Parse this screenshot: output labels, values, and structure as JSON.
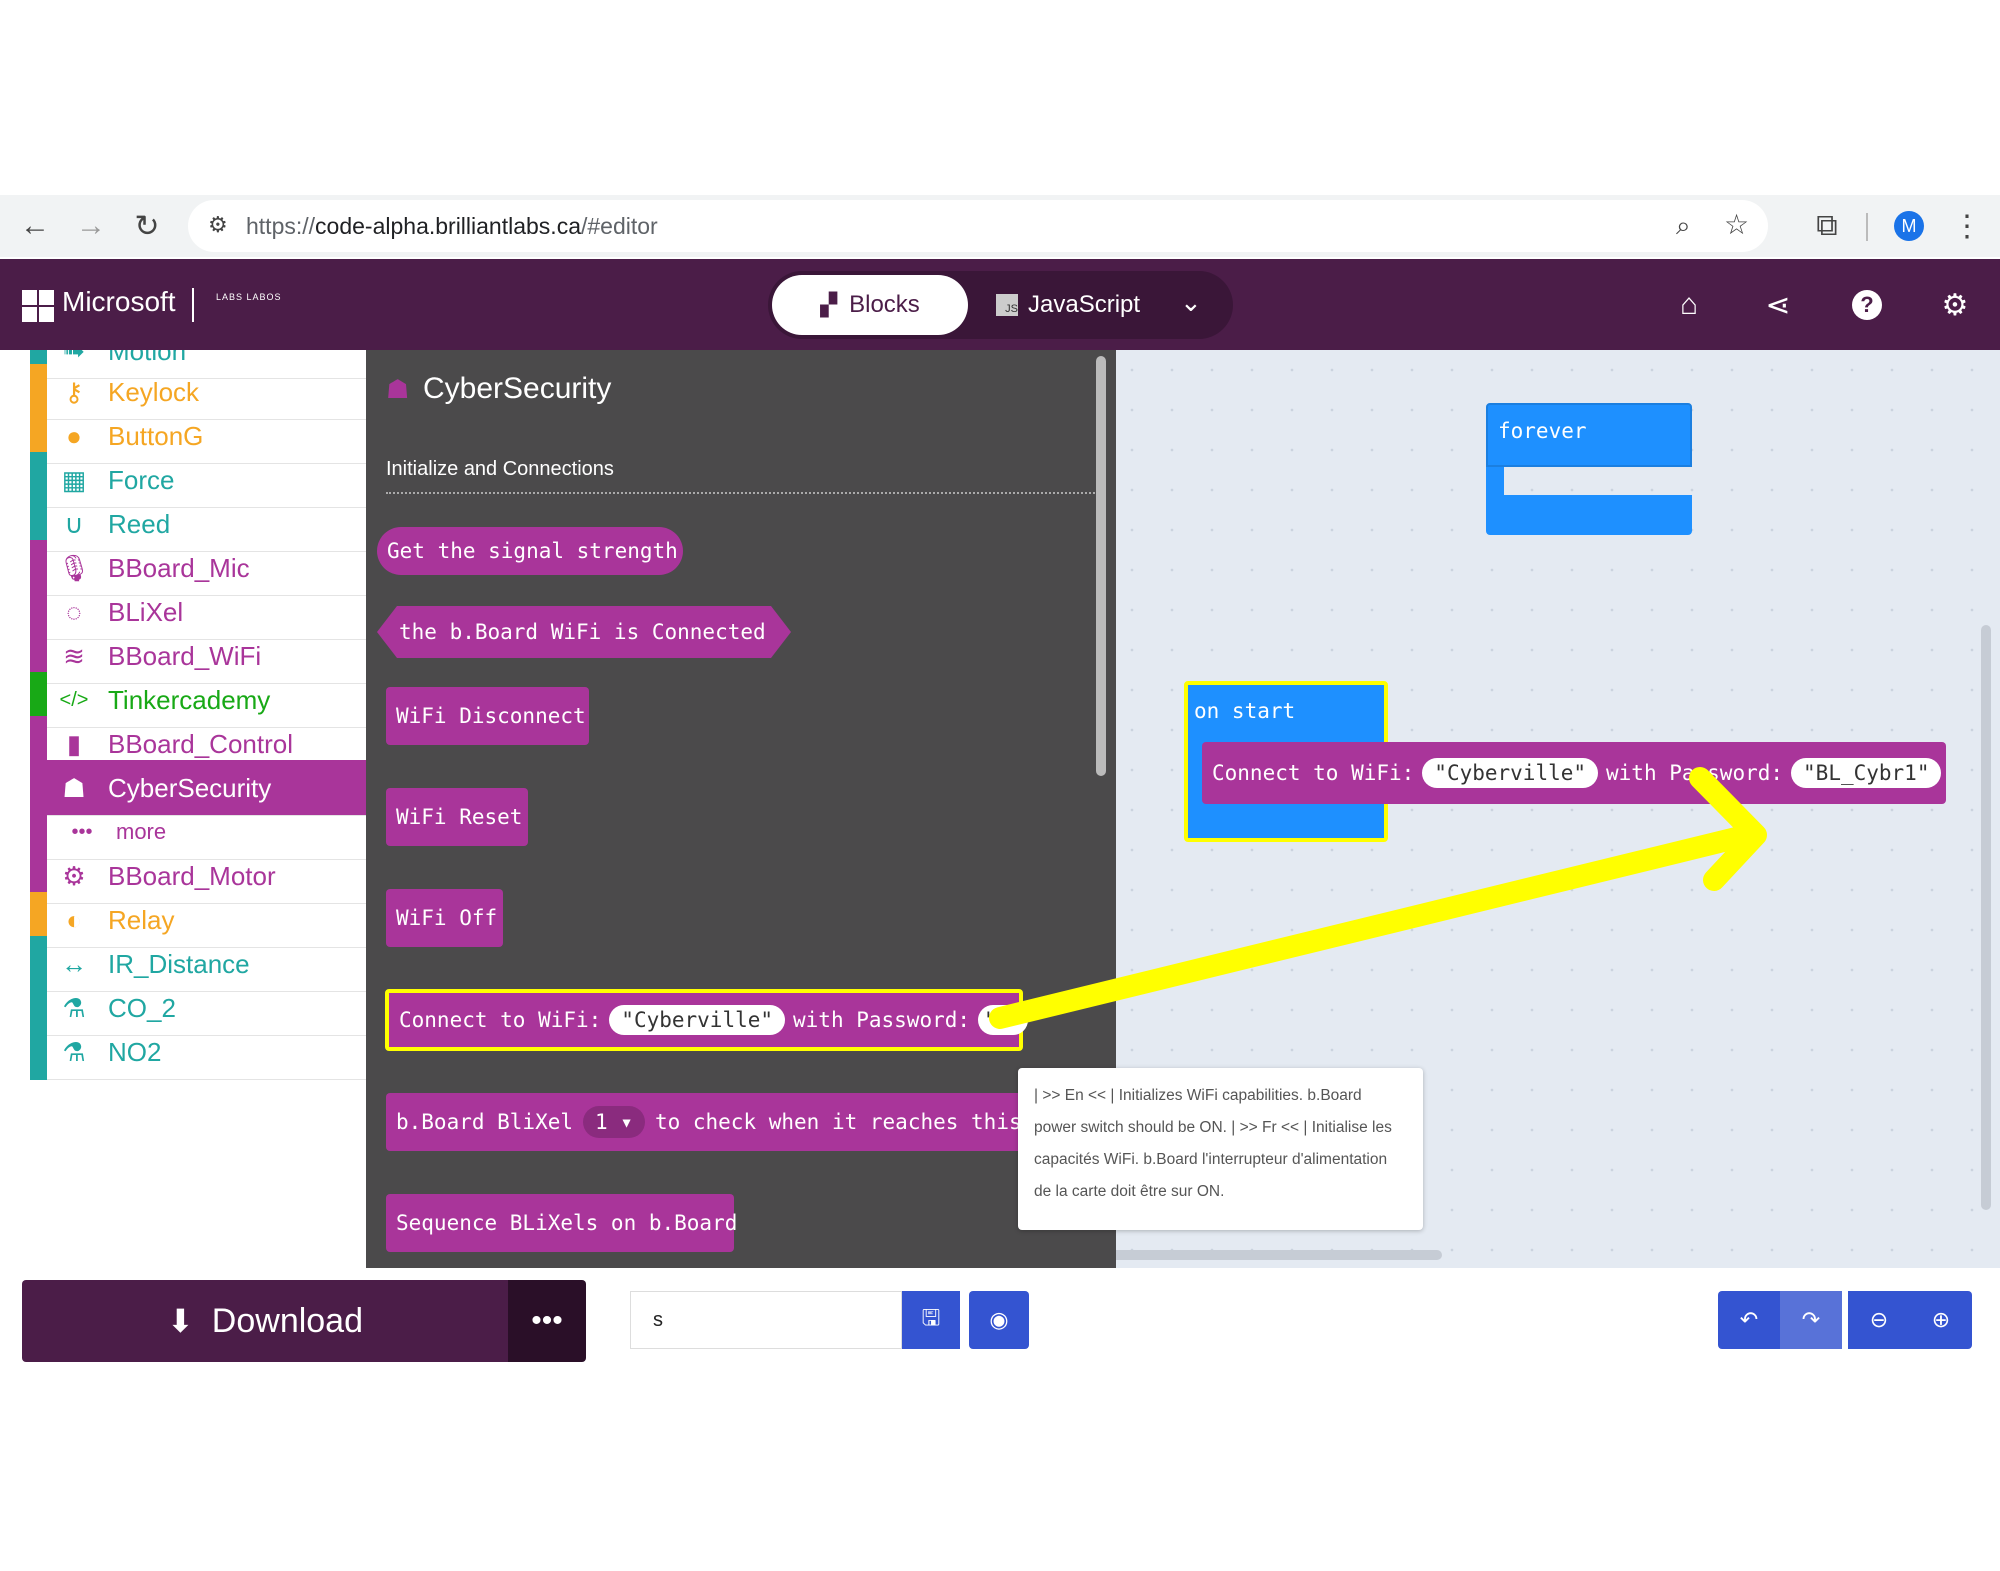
{
  "browser": {
    "url_prefix": "https://",
    "url_main": "code-alpha.brilliantlabs.ca",
    "url_suffix": "/#editor",
    "profile_initial": "M"
  },
  "header": {
    "brand": "Microsoft",
    "partner_logo_text": "LABS LABOS",
    "tabs": {
      "blocks": "Blocks",
      "javascript": "JavaScript"
    }
  },
  "sidebar": {
    "categories": [
      {
        "label": "Motion",
        "icon": "motion-icon",
        "color": "#20a7a2"
      },
      {
        "label": "Keylock",
        "icon": "key-icon",
        "color": "#f5a623"
      },
      {
        "label": "ButtonG",
        "icon": "circle-icon",
        "color": "#f5a623"
      },
      {
        "label": "Force",
        "icon": "grid-icon",
        "color": "#20a7a2"
      },
      {
        "label": "Reed",
        "icon": "magnet-icon",
        "color": "#20a7a2"
      },
      {
        "label": "BBoard_Mic",
        "icon": "microphone-icon",
        "color": "#a9359a"
      },
      {
        "label": "BLiXel",
        "icon": "ring-icon",
        "color": "#a9359a"
      },
      {
        "label": "BBoard_WiFi",
        "icon": "wifi-icon",
        "color": "#a9359a"
      },
      {
        "label": "Tinkercademy",
        "icon": "code-icon",
        "color": "#18a916"
      },
      {
        "label": "BBoard_Control",
        "icon": "chip-icon",
        "color": "#a9359a"
      },
      {
        "label": "CyberSecurity",
        "icon": "spy-icon",
        "color": "#a9359a"
      },
      {
        "label": "more",
        "icon": "ellipsis-icon",
        "color": "#a9359a"
      },
      {
        "label": "BBoard_Motor",
        "icon": "gears-icon",
        "color": "#a9359a"
      },
      {
        "label": "Relay",
        "icon": "toggle-icon",
        "color": "#f5a623"
      },
      {
        "label": "IR_Distance",
        "icon": "arrows-icon",
        "color": "#20a7a2"
      },
      {
        "label": "CO_2",
        "icon": "flask-icon",
        "color": "#20a7a2"
      },
      {
        "label": "NO2",
        "icon": "flask-icon",
        "color": "#20a7a2"
      }
    ]
  },
  "flyout": {
    "title": "CyberSecurity",
    "section": "Initialize and Connections",
    "blocks": {
      "signal": "Get the signal strength",
      "connected": "the b.Board WiFi is Connected",
      "disconnect": "WiFi Disconnect",
      "reset": "WiFi Reset",
      "off": "WiFi Off",
      "connect_label": "Connect to WiFi:",
      "connect_ssid": "\"Cyberville\"",
      "connect_pw_label": "with Password:",
      "connect_pw": "\" \"",
      "blixel_a": "b.Board BliXel",
      "blixel_num": "1 ▾",
      "blixel_b": "to check when it reaches this",
      "sequence": "Sequence BLiXels on b.Board"
    }
  },
  "tooltip": {
    "text": "| >> En << | Initializes WiFi capabilities. b.Board power switch should be ON. | >> Fr << | Initialise les capacités WiFi. b.Board l'interrupteur d'alimentation de la carte doit être sur ON."
  },
  "workspace": {
    "forever": "forever",
    "on_start": "on start",
    "connect_label": "Connect to WiFi:",
    "ssid": "\"Cyberville\"",
    "pw_label": "with Password:",
    "pw": "\"BL_Cybr1\""
  },
  "bottom": {
    "download": "Download",
    "more": "•••",
    "project_name": "s"
  },
  "colors": {
    "header": "#4b1d48",
    "block_magenta": "#a9359a",
    "loop_blue": "#1e90ff",
    "highlight_yellow": "#ffff00",
    "action_blue": "#3454d1"
  }
}
